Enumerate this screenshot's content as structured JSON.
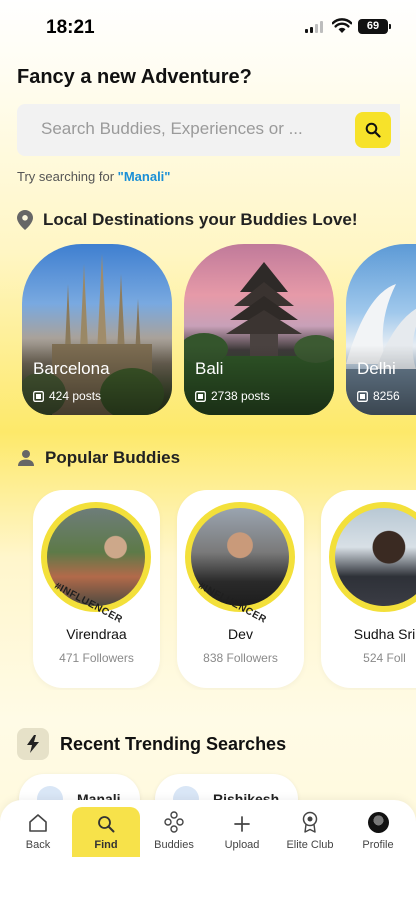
{
  "status": {
    "time": "18:21",
    "battery": "69"
  },
  "page_title": "Fancy a new Adventure?",
  "search": {
    "placeholder": "Search Buddies, Experiences or ...",
    "value": ""
  },
  "try": {
    "prefix": "Try searching for ",
    "term": "\"Manali\""
  },
  "destinations": {
    "heading": "Local Destinations your Buddies Love!",
    "items": [
      {
        "name": "Barcelona",
        "posts": "424 posts"
      },
      {
        "name": "Bali",
        "posts": "2738 posts"
      },
      {
        "name": "Delhi",
        "posts": "8256"
      }
    ]
  },
  "buddies": {
    "heading": "Popular Buddies",
    "items": [
      {
        "name": "Virendraa",
        "followers": "471 Followers",
        "tag": "#INFLUENCER"
      },
      {
        "name": "Dev",
        "followers": "838 Followers",
        "tag": "#INFLUENCER"
      },
      {
        "name": "Sudha Sri",
        "followers": "524 Foll"
      }
    ]
  },
  "trending": {
    "heading": "Recent Trending Searches",
    "items": [
      {
        "label": "Manali"
      },
      {
        "label": "Rishikesh"
      }
    ]
  },
  "nav": {
    "items": [
      {
        "label": "Back",
        "icon": "home-icon"
      },
      {
        "label": "Find",
        "icon": "search-icon",
        "active": true
      },
      {
        "label": "Buddies",
        "icon": "buddies-icon"
      },
      {
        "label": "Upload",
        "icon": "plus-icon"
      },
      {
        "label": "Elite Club",
        "icon": "badge-icon"
      },
      {
        "label": "Profile",
        "icon": "avatar"
      }
    ]
  },
  "colors": {
    "accent": "#f7e22a",
    "link": "#1a8fd6"
  }
}
